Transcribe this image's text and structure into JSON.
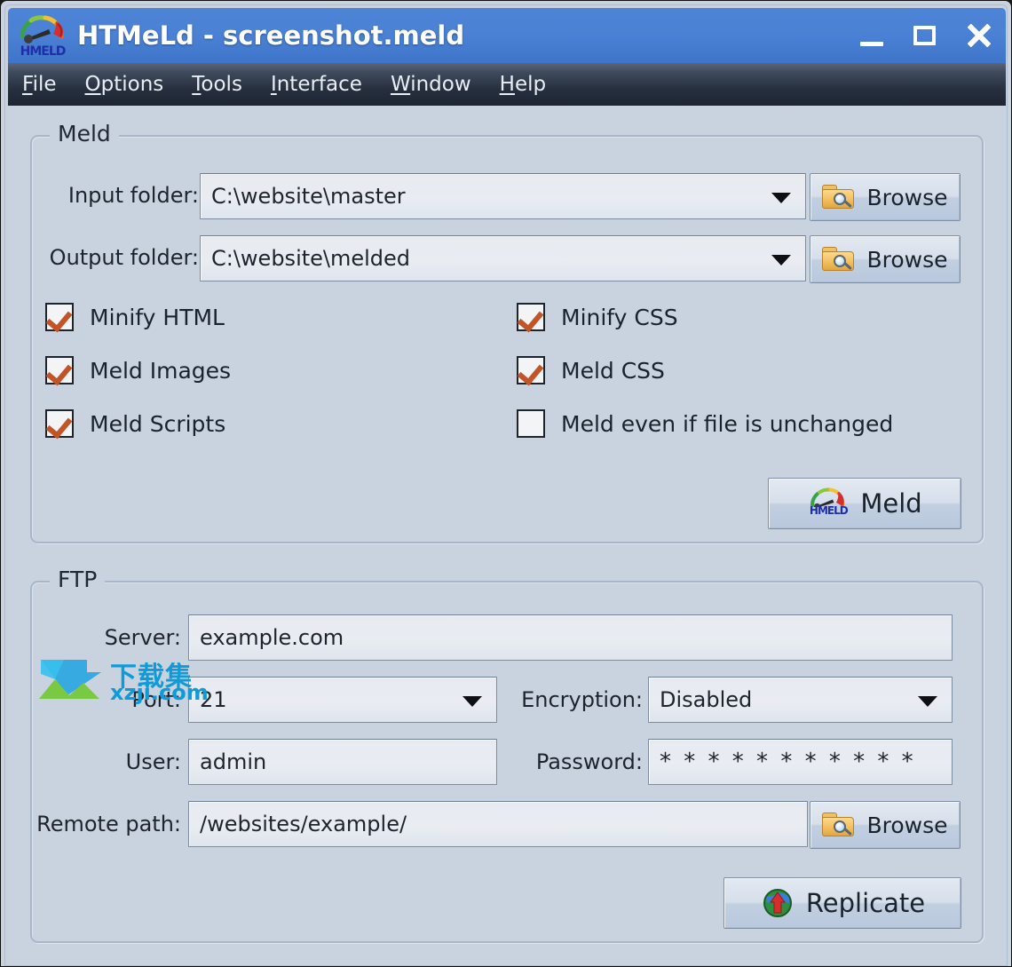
{
  "window": {
    "title": "HTMeLd - screenshot.meld",
    "app_icon": "meld-gauge-icon",
    "controls": {
      "minimize": "minimize-icon",
      "maximize": "maximize-icon",
      "close": "close-icon"
    }
  },
  "menubar": [
    {
      "label": "File",
      "accel": "F"
    },
    {
      "label": "Options",
      "accel": "O"
    },
    {
      "label": "Tools",
      "accel": "T"
    },
    {
      "label": "Interface",
      "accel": "I"
    },
    {
      "label": "Window",
      "accel": "W"
    },
    {
      "label": "Help",
      "accel": "H"
    }
  ],
  "meld_group": {
    "legend": "Meld",
    "input_folder": {
      "label": "Input folder:",
      "value": "C:\\website\\master",
      "browse_label": "Browse"
    },
    "output_folder": {
      "label": "Output folder:",
      "value": "C:\\website\\melded",
      "browse_label": "Browse"
    },
    "checkboxes_left": [
      {
        "label": "Minify HTML",
        "checked": true
      },
      {
        "label": "Meld Images",
        "checked": true
      },
      {
        "label": "Meld Scripts",
        "checked": true
      }
    ],
    "checkboxes_right": [
      {
        "label": "Minify CSS",
        "checked": true
      },
      {
        "label": "Meld CSS",
        "checked": true
      },
      {
        "label": "Meld even if file is unchanged",
        "checked": false
      }
    ],
    "action_button": "Meld"
  },
  "ftp_group": {
    "legend": "FTP",
    "server": {
      "label": "Server:",
      "value": "example.com"
    },
    "port": {
      "label": "Port:",
      "value": "21"
    },
    "encryption": {
      "label": "Encryption:",
      "value": "Disabled"
    },
    "user": {
      "label": "User:",
      "value": "admin"
    },
    "password": {
      "label": "Password:",
      "value": "* * * * * * * * * * *"
    },
    "remote_path": {
      "label": "Remote path:",
      "value": "/websites/example/",
      "browse_label": "Browse"
    },
    "action_button": "Replicate"
  },
  "watermark": {
    "cn_text": "下载集",
    "url_text": "xzji.com"
  },
  "colors": {
    "titlebar": "#4a81d4",
    "menubar": "#2b3443",
    "client_bg": "#c9d3e0",
    "check_mark": "#c25427",
    "accent_blue": "#0f9bd7"
  }
}
